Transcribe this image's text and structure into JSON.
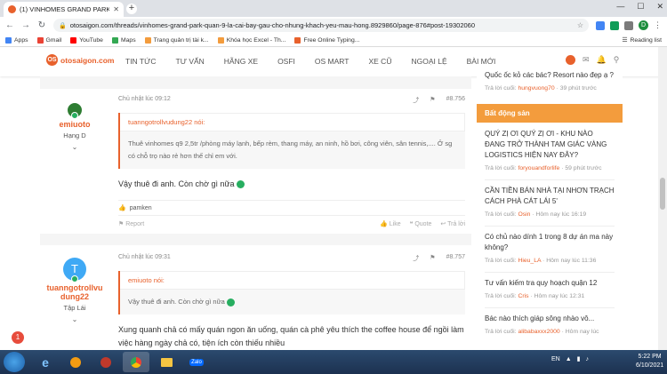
{
  "browser": {
    "tab_title": "(1) VINHOMES GRAND PARK Q...",
    "url": "otosaigon.com/threads/vinhomes-grand-park-quan-9-la-cai-bay-gau-cho-nhung-khach-yeu-mau-hong.8929860/page-876#post-19302060",
    "profile_initial": "D",
    "bookmarks": [
      "Apps",
      "Gmail",
      "YouTube",
      "Maps",
      "Trang quản trị tài k...",
      "Khóa học Excel - Th...",
      "Free Online Typing..."
    ],
    "reading_list": "Reading list"
  },
  "site": {
    "logo_text": "otosaigon.com",
    "nav": [
      "TIN TỨC",
      "TƯ VẤN",
      "HÃNG XE",
      "OSFI",
      "OS MART",
      "XE CŨ",
      "NGOẠI LỆ",
      "BÀI MỚI"
    ]
  },
  "posts": [
    {
      "username": "emiuoto",
      "rank": "Hạng D",
      "time": "Chủ nhật lúc 09:12",
      "number": "#8.756",
      "quote_author": "tuanngotrollvudung22 nói:",
      "quote_text": "Thuê vinhomes q9 2,5tr /phòng máy lạnh, bếp rèm, thang máy, an ninh, hồ bơi, công viên, sân tennis,.... Ở sg có chỗ trọ nào rẻ hơn thế chỉ em với.",
      "message": "Vậy thuê đi anh. Còn chờ gì nữa",
      "reactor": "pamken",
      "actions": {
        "report": "Report",
        "like": "Like",
        "quote": "Quote",
        "reply": "Trả lời"
      }
    },
    {
      "username": "tuanngotrollvudung22",
      "username_line1": "tuanngotrollvu",
      "username_line2": "dung22",
      "avatar_letter": "T",
      "rank": "Tập Lái",
      "time": "Chủ nhật lúc 09:31",
      "number": "#8.757",
      "quote_author": "emiuoto nói:",
      "quote_text": "Vậy thuê đi anh. Còn chờ gì nữa",
      "message": "Xung quanh chả có mấy quán ngon ăn uống, quán cà phê yêu thích the coffee house để ngồi làm việc hàng ngày chả có, tiện ích còn thiếu nhiều"
    }
  ],
  "sidebar": {
    "top_item": {
      "title": "Quốc ốc kỏ các bác? Resort nào đẹp ạ ?",
      "meta_prefix": "Trả lời cuối:",
      "user": "hungvuong70",
      "time": "39 phút trước"
    },
    "section_title": "Bất động sản",
    "items": [
      {
        "title": "QUÝ ZỊ ƠI QUÝ ZỊ ƠI - KHU NÀO ĐANG TRỞ THÀNH TAM GIÁC VÀNG LOGISTICS HIỆN NAY ĐÂY?",
        "user": "foryouandforlife",
        "time": "59 phút trước"
      },
      {
        "title": "CẦN TIỀN BÁN NHÀ TẠI NHƠN TRẠCH CÁCH PHÀ CÁT LÁI 5'",
        "user": "Osin",
        "time": "Hôm nay lúc 16:19"
      },
      {
        "title": "Có chủ nào dính 1 trong 8 dự án ma này không?",
        "user": "Hieu_LA",
        "time": "Hôm nay lúc 11:36"
      },
      {
        "title": "Tư vấn kiếm tra quy hoạch quận 12",
        "user": "Cris",
        "time": "Hôm nay lúc 12:31"
      },
      {
        "title": "Bác nào thích giáp sông nhào vô...",
        "user": "alibabaxxx2000",
        "time": "Hôm nay lúc"
      }
    ],
    "meta_prefix": "Trả lời cuối:"
  },
  "notification_count": "1",
  "taskbar": {
    "lang": "EN",
    "time": "5:22 PM",
    "date": "6/10/2021",
    "zalo": "Zalo"
  }
}
